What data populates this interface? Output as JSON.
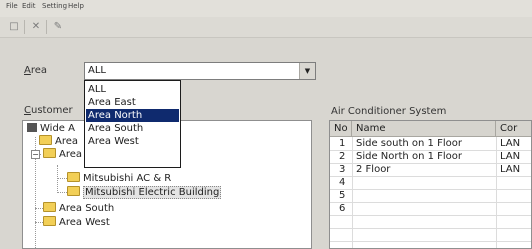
{
  "menu": {
    "file": "File",
    "edit": "Edit",
    "setting": "Setting",
    "help": "Help"
  },
  "toolbar": {
    "icons": [
      "new-icon",
      "delete-icon",
      "edit-icon"
    ],
    "btn_glyphs": [
      "□",
      "✕",
      "✎"
    ]
  },
  "area": {
    "label": "Area",
    "selected": "ALL",
    "options": [
      "ALL",
      "Area East",
      "Area North",
      "Area South",
      "Area West"
    ],
    "highlighted": "Area North"
  },
  "customer_label": "Customer",
  "tree": {
    "root": "Wide Area",
    "root_visible": "Wide A",
    "area_east_visible": "Area",
    "area_north_visible": "Area North",
    "children_north": [
      "Mitsubishi AC & R",
      "Mitsubishi Electric Building"
    ],
    "area_south": "Area South",
    "area_west": "Area West"
  },
  "ac_panel": {
    "title": "Air Conditioner System",
    "columns": [
      "No",
      "Name",
      "Cor"
    ],
    "rows": [
      {
        "no": "1",
        "name": "Side south on 1 Floor",
        "c": "LAN"
      },
      {
        "no": "2",
        "name": "Side North on 1 Floor",
        "c": "LAN"
      },
      {
        "no": "3",
        "name": "2 Floor",
        "c": "LAN"
      },
      {
        "no": "4",
        "name": "",
        "c": ""
      },
      {
        "no": "5",
        "name": "",
        "c": ""
      },
      {
        "no": "6",
        "name": "",
        "c": ""
      }
    ]
  },
  "colors": {
    "selection": "#0f2a6e",
    "folder": "#f2cf57"
  }
}
